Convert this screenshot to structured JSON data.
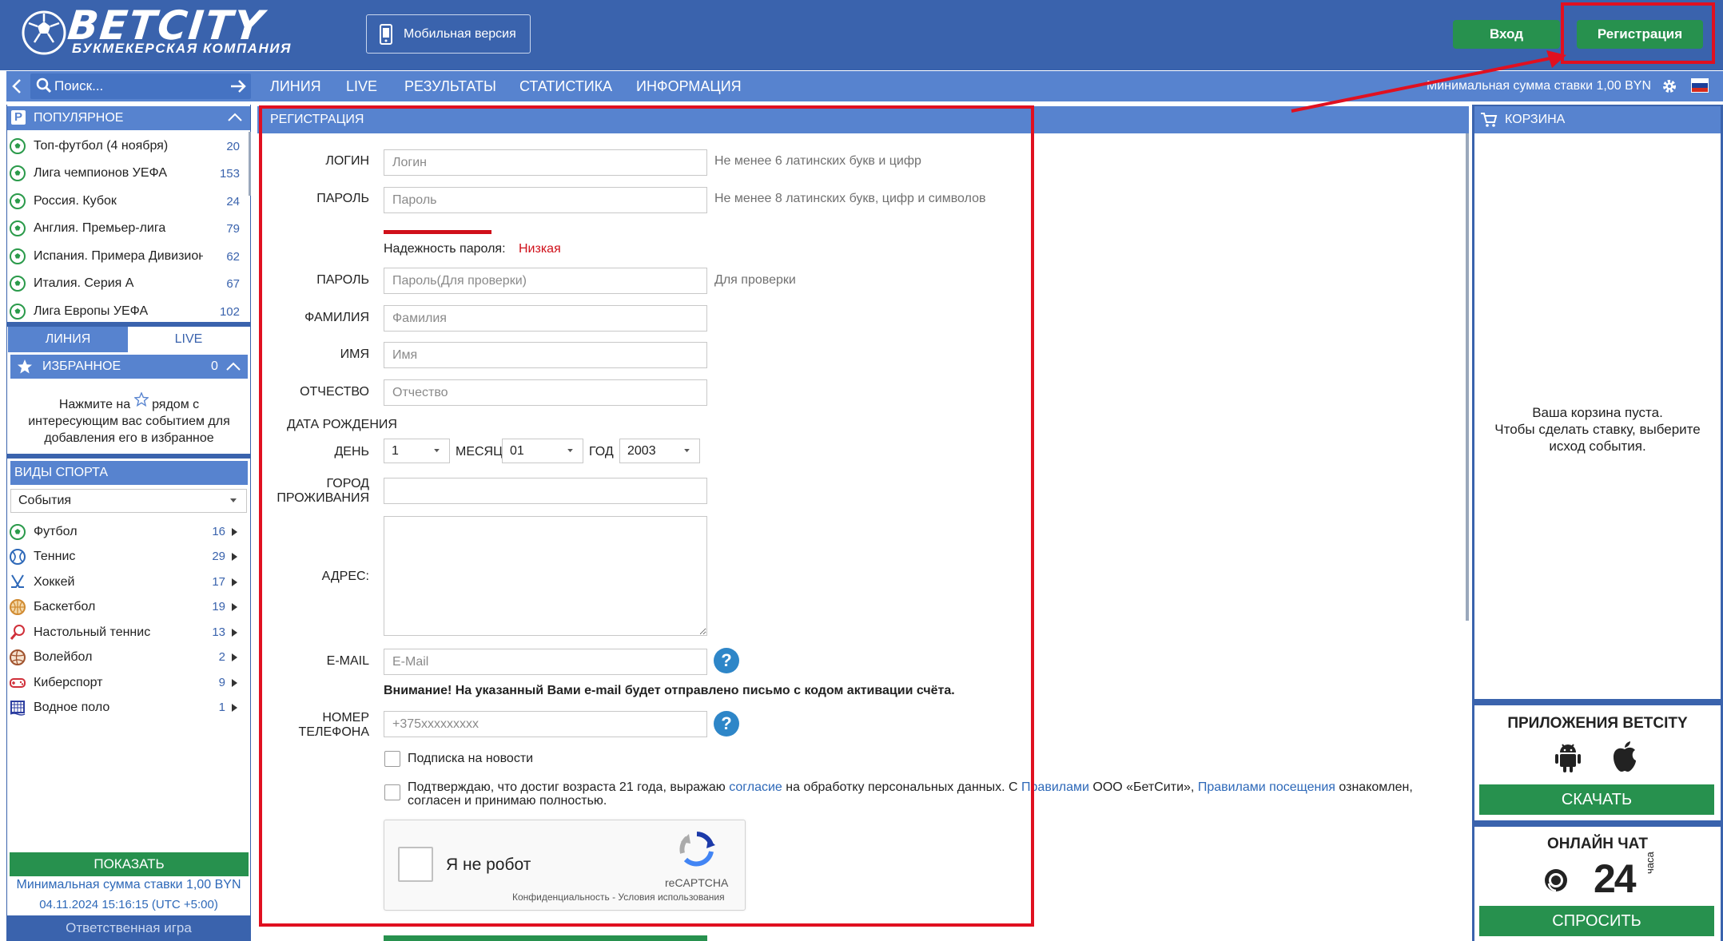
{
  "header": {
    "logo_text": "BETCITY",
    "logo_subtitle": "БУКМЕКЕРСКАЯ КОМПАНИЯ",
    "mobile_label": "Мобильная версия",
    "login_label": "Вход",
    "register_label": "Регистрация"
  },
  "nav": {
    "search_placeholder": "Поиск...",
    "items": [
      "ЛИНИЯ",
      "LIVE",
      "РЕЗУЛЬТАТЫ",
      "СТАТИСТИКА",
      "ИНФОРМАЦИЯ"
    ],
    "min_stake": "Минимальная сумма ставки 1,00 BYN"
  },
  "sidebar": {
    "popular_title": "ПОПУЛЯРНОЕ",
    "popular": [
      {
        "label": "Топ-футбол (4 ноября)",
        "count": "20"
      },
      {
        "label": "Лига чемпионов УЕФА",
        "count": "153"
      },
      {
        "label": "Россия. Кубок",
        "count": "24"
      },
      {
        "label": "Англия. Премьер-лига",
        "count": "79"
      },
      {
        "label": "Испания. Примера Дивизион",
        "count": "62"
      },
      {
        "label": "Италия. Серия А",
        "count": "67"
      },
      {
        "label": "Лига Европы УЕФА",
        "count": "102"
      }
    ],
    "tab_line": "ЛИНИЯ",
    "tab_live": "LIVE",
    "favorites_title": "ИЗБРАННОЕ",
    "favorites_count": "0",
    "fav_text_1": "Нажмите на",
    "fav_text_2": "рядом с",
    "fav_text_3": "интересующим вас событием для",
    "fav_text_4": "добавления его в избранное",
    "sports_title": "ВИДЫ СПОРТА",
    "sports_select": "События",
    "sports": [
      {
        "label": "Футбол",
        "count": "16",
        "icon": "football-icon"
      },
      {
        "label": "Теннис",
        "count": "29",
        "icon": "tennis-icon"
      },
      {
        "label": "Хоккей",
        "count": "17",
        "icon": "hockey-icon"
      },
      {
        "label": "Баскетбол",
        "count": "19",
        "icon": "basketball-icon"
      },
      {
        "label": "Настольный теннис",
        "count": "13",
        "icon": "table-tennis-icon"
      },
      {
        "label": "Волейбол",
        "count": "2",
        "icon": "volleyball-icon"
      },
      {
        "label": "Киберспорт",
        "count": "9",
        "icon": "esports-icon"
      },
      {
        "label": "Водное поло",
        "count": "1",
        "icon": "water-polo-icon"
      }
    ],
    "show_label": "ПОКАЗАТЬ",
    "min_stake": "Минимальная сумма ставки 1,00 BYN",
    "datetime": "04.11.2024 15:16:15 (UTC +5:00)",
    "responsible": "Ответственная игра"
  },
  "form": {
    "title": "РЕГИСТРАЦИЯ",
    "login_label": "ЛОГИН",
    "login_placeholder": "Логин",
    "login_hint": "Не менее 6 латинских букв и цифр",
    "password_label": "ПАРОЛЬ",
    "password_placeholder": "Пароль",
    "password_hint": "Не менее 8 латинских букв, цифр и символов",
    "strength_label": "Надежность пароля:",
    "strength_value": "Низкая",
    "password2_label": "ПАРОЛЬ",
    "password2_placeholder": "Пароль(Для проверки)",
    "password2_hint": "Для проверки",
    "surname_label": "ФАМИЛИЯ",
    "surname_placeholder": "Фамилия",
    "name_label": "ИМЯ",
    "name_placeholder": "Имя",
    "patronymic_label": "ОТЧЕСТВО",
    "patronymic_placeholder": "Отчество",
    "birth_label": "ДАТА РОЖДЕНИЯ",
    "day_label": "ДЕНЬ",
    "day_value": "1",
    "month_label": "МЕСЯЦ",
    "month_value": "01",
    "year_label": "ГОД",
    "year_value": "2003",
    "city_label_1": "ГОРОД",
    "city_label_2": "ПРОЖИВАНИЯ",
    "address_label": "АДРЕС:",
    "email_label": "E-MAIL",
    "email_placeholder": "E-Mail",
    "email_warning": "Внимание! На указанный Вами e-mail будет отправлено письмо с кодом активации счёта.",
    "phone_label_1": "НОМЕР",
    "phone_label_2": "ТЕЛЕФОНА",
    "phone_placeholder": "+375xxxxxxxxx",
    "newsletter_label": "Подписка на новости",
    "consent_1": "Подтверждаю, что достиг возраста 21 года, выражаю",
    "consent_link_1": "согласие",
    "consent_2": "на обработку персональных данных. С",
    "consent_link_2": "Правилами",
    "consent_3": "ООО «БетСити»,",
    "consent_link_3": "Правилами посещения",
    "consent_4": "ознакомлен,",
    "consent_5": "согласен и принимаю полностью.",
    "captcha_label": "Я не робот",
    "captcha_brand": "reCAPTCHA",
    "captcha_privacy": "Конфиденциальность",
    "captcha_sep": " - ",
    "captcha_terms": "Условия использования",
    "question_mark": "?"
  },
  "right": {
    "cart_title": "КОРЗИНА",
    "cart_empty_1": "Ваша корзина пуста.",
    "cart_empty_2": "Чтобы сделать ставку, выберите",
    "cart_empty_3": "исход события.",
    "apps_title": "ПРИЛОЖЕНИЯ BETCITY",
    "download_label": "СКАЧАТЬ",
    "chat_title": "ОНЛАЙН ЧАТ",
    "chat_24": "24",
    "chat_hours": "часа",
    "ask_label": "СПРОСИТЬ"
  },
  "colors": {
    "header_blue": "#3a63ad",
    "nav_blue": "#5783cf",
    "green": "#27914e",
    "annotation_red": "#e01020"
  }
}
